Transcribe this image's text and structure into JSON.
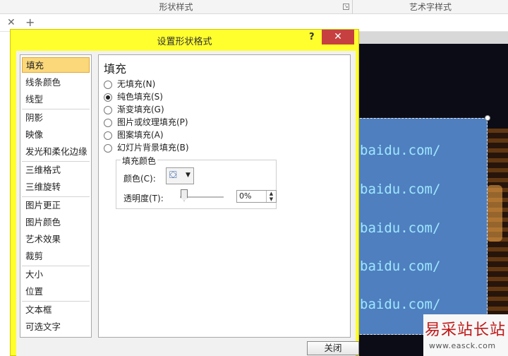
{
  "ribbon": {
    "group_shape_styles": "形状样式",
    "group_wordart_styles": "艺术字样式"
  },
  "tabbar": {
    "close_glyph": "✕",
    "add_glyph": "+"
  },
  "dialog": {
    "title": "设置形状格式",
    "help": "?",
    "close": "✕",
    "nav": [
      "填充",
      "线条颜色",
      "线型",
      "阴影",
      "映像",
      "发光和柔化边缘",
      "三维格式",
      "三维旋转",
      "图片更正",
      "图片颜色",
      "艺术效果",
      "裁剪",
      "大小",
      "位置",
      "文本框",
      "可选文字"
    ],
    "selected_nav": "填充",
    "panel": {
      "title": "填充",
      "options": [
        "无填充(N)",
        "纯色填充(S)",
        "渐变填充(G)",
        "图片或纹理填充(P)",
        "图案填充(A)",
        "幻灯片背景填充(B)"
      ],
      "selected_option": "纯色填充(S)",
      "group": {
        "legend": "填充颜色",
        "color_label": "颜色(C):",
        "transparency_label": "透明度(T):",
        "transparency_value": "0%",
        "transparency": 0
      }
    },
    "close_button": "关闭"
  },
  "slide": {
    "lines": [
      "baidu.com/",
      "baidu.com/",
      "baidu.com/",
      "baidu.com/",
      "baidu.com/"
    ],
    "box_fill": "#4f7fbf",
    "text_color": "#9fe8ff"
  },
  "watermark": {
    "title": "易采站长站",
    "url": "www.easck.com"
  }
}
